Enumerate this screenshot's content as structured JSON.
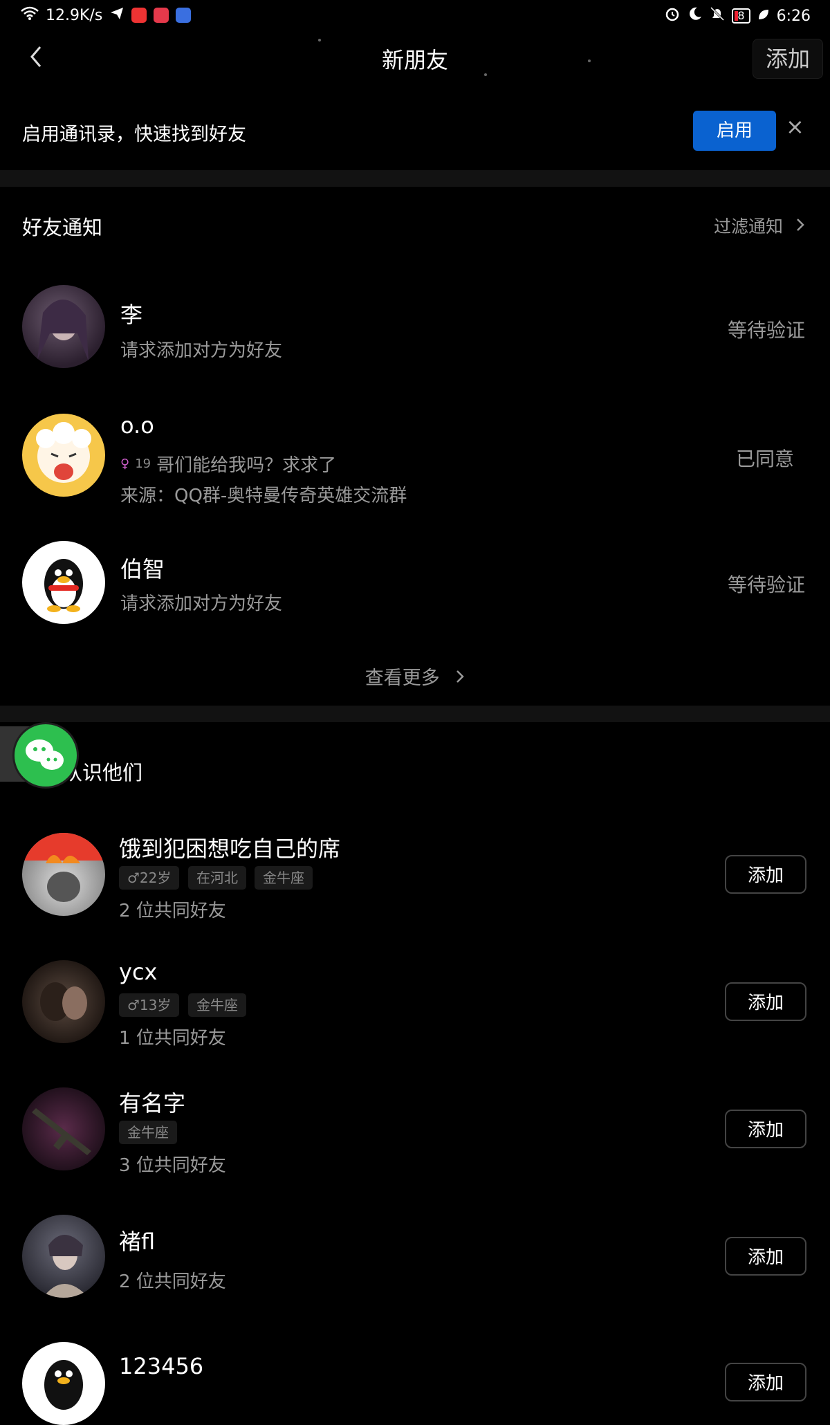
{
  "status_bar": {
    "speed": "12.9K/s",
    "battery": "8",
    "time": "6:26"
  },
  "nav": {
    "title": "新朋友",
    "add_label": "添加"
  },
  "banner": {
    "text": "启用通讯录，快速找到好友",
    "enable_label": "启用",
    "close_label": "×"
  },
  "notifications": {
    "title": "好友通知",
    "filter_label": "过滤通知",
    "items": [
      {
        "name": "李",
        "desc": "请求添加对方为好友",
        "status": "等待验证"
      },
      {
        "name": "o.o",
        "age": "19",
        "desc": "哥们能给我吗？求求了",
        "source": "来源：QQ群-奥特曼传奇英雄交流群",
        "status": "已同意"
      },
      {
        "name": "伯智",
        "desc": "请求添加对方为好友",
        "status": "等待验证"
      }
    ],
    "more_label": "查看更多"
  },
  "suggestions": {
    "title": "可能认识他们",
    "items": [
      {
        "name": "饿到犯困想吃自己的席",
        "tags": [
          "♂22岁",
          "在河北",
          "金牛座"
        ],
        "mutual": "2 位共同好友",
        "add_label": "添加"
      },
      {
        "name": "ycx",
        "tags": [
          "♂13岁",
          "金牛座"
        ],
        "mutual": "1 位共同好友",
        "add_label": "添加"
      },
      {
        "name": "有名字",
        "tags": [
          "金牛座"
        ],
        "mutual": "3 位共同好友",
        "add_label": "添加"
      },
      {
        "name": "褚fl",
        "tags": [],
        "mutual": "2 位共同好友",
        "add_label": "添加"
      },
      {
        "name": "123456",
        "tags": [],
        "mutual": "",
        "add_label": "添加"
      }
    ]
  },
  "colors": {
    "accent": "#0a62d0",
    "background": "#000000",
    "secondary_text": "#9a9a9a"
  }
}
